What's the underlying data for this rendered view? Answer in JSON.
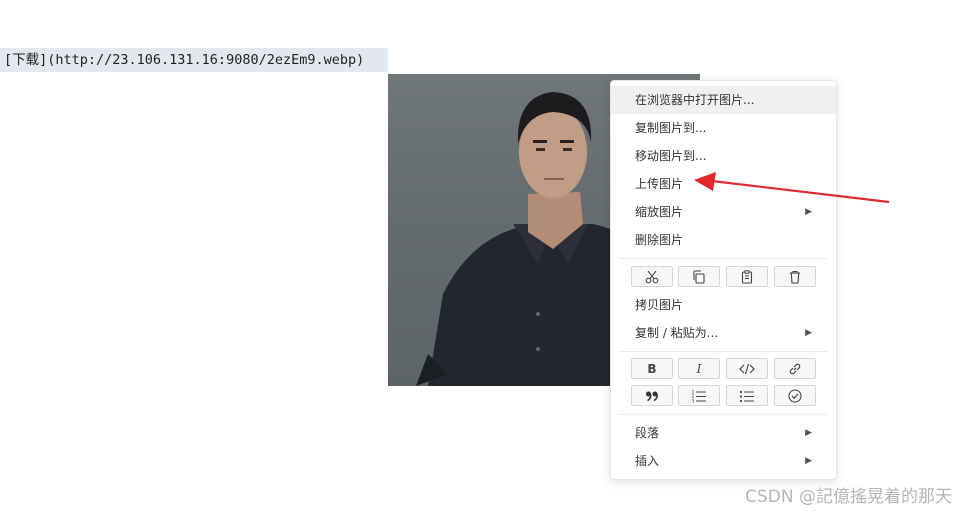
{
  "editor": {
    "markdown_line": "[下载](http://23.106.131.16:9080/2ezEm9.webp)"
  },
  "context_menu": {
    "items_top": [
      {
        "label": "在浏览器中打开图片..."
      },
      {
        "label": "复制图片到..."
      },
      {
        "label": "移动图片到..."
      },
      {
        "label": "上传图片"
      },
      {
        "label": "缩放图片",
        "submenu": true
      },
      {
        "label": "删除图片"
      }
    ],
    "toolbar1": [
      "scissors-icon",
      "copy-icon",
      "clipboard-icon",
      "trash-icon"
    ],
    "items_mid": [
      {
        "label": "拷贝图片"
      },
      {
        "label": "复制 / 粘贴为...",
        "submenu": true
      }
    ],
    "format_row1": [
      "B",
      "I",
      "code-icon",
      "link-icon"
    ],
    "format_row2": [
      "quote-icon",
      "ordered-list-icon",
      "bullet-list-icon",
      "task-list-icon"
    ],
    "items_bottom": [
      {
        "label": "段落",
        "submenu": true
      },
      {
        "label": "插入",
        "submenu": true
      }
    ],
    "submenu_indicator": "▶"
  },
  "annotation": {
    "arrow_color": "#e0282d"
  },
  "watermark": "CSDN @記億搖晃着的那天"
}
